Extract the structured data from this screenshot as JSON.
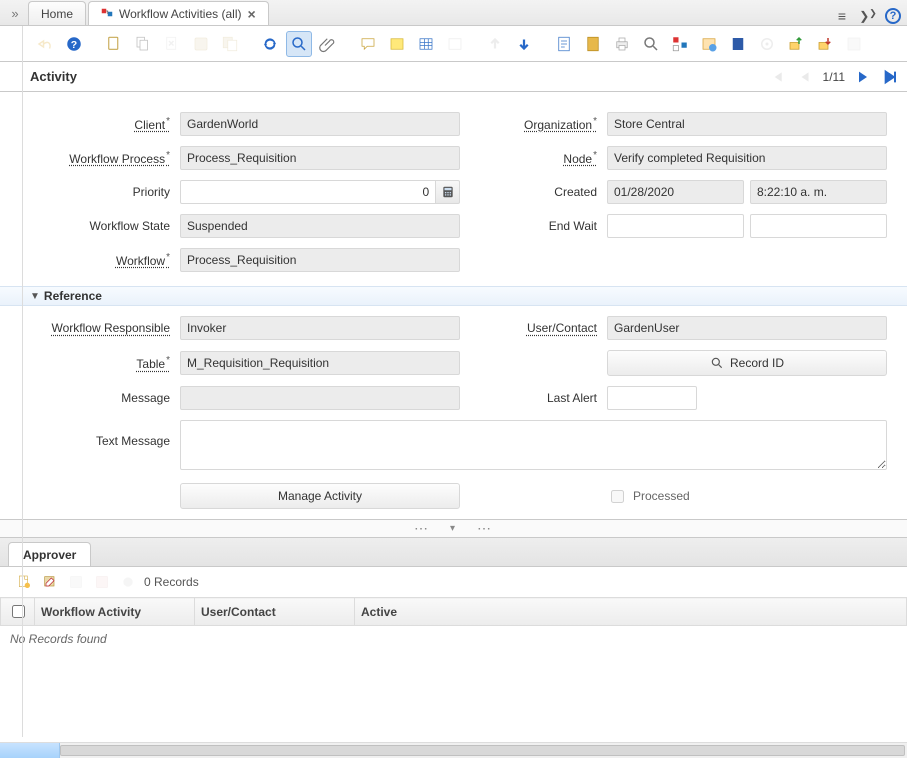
{
  "tabs": {
    "home": "Home",
    "active": {
      "label": "Workflow Activities (all)"
    }
  },
  "header": {
    "title": "Activity",
    "record_counter": "1/11"
  },
  "fields": {
    "client": {
      "label": "Client",
      "value": "GardenWorld"
    },
    "organization": {
      "label": "Organization",
      "value": "Store Central"
    },
    "workflow_process": {
      "label": "Workflow Process",
      "value": "Process_Requisition"
    },
    "node": {
      "label": "Node",
      "value": "Verify completed Requisition"
    },
    "priority": {
      "label": "Priority",
      "value": "0"
    },
    "created": {
      "label": "Created",
      "date": "01/28/2020",
      "time": "8:22:10 a. m."
    },
    "workflow_state": {
      "label": "Workflow State",
      "value": "Suspended"
    },
    "end_wait": {
      "label": "End Wait",
      "date": "",
      "time": ""
    },
    "workflow": {
      "label": "Workflow",
      "value": "Process_Requisition"
    },
    "reference_section": "Reference",
    "workflow_responsible": {
      "label": "Workflow Responsible",
      "value": "Invoker"
    },
    "user_contact": {
      "label": "User/Contact",
      "value": "GardenUser"
    },
    "table": {
      "label": "Table",
      "value": "M_Requisition_Requisition"
    },
    "record_id_button": "Record ID",
    "message": {
      "label": "Message",
      "value": ""
    },
    "last_alert": {
      "label": "Last Alert",
      "value": ""
    },
    "text_message": {
      "label": "Text Message",
      "value": ""
    },
    "manage_activity_button": "Manage Activity",
    "processed": {
      "label": "Processed",
      "checked": false
    }
  },
  "detail": {
    "tab": "Approver",
    "records_text": "0 Records",
    "columns": [
      "Workflow Activity",
      "User/Contact",
      "Active"
    ],
    "no_records": "No Records found"
  },
  "icons": {
    "menu": "≡",
    "collapse": "›",
    "help": "?"
  }
}
